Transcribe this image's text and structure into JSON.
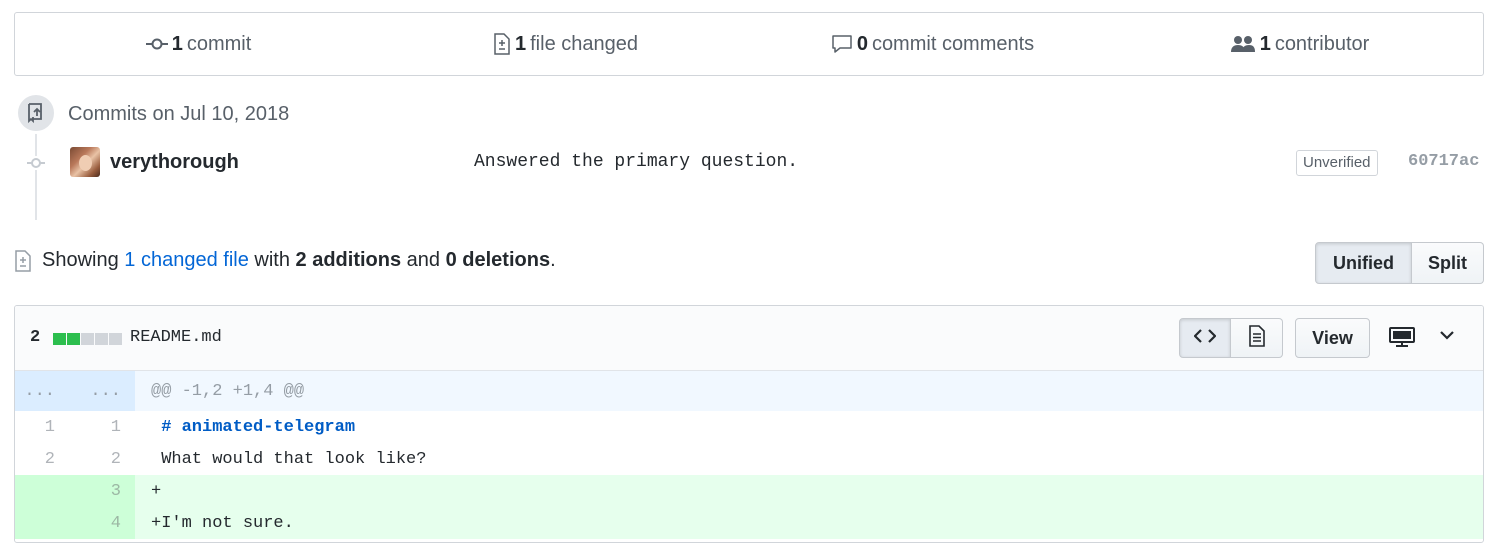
{
  "summary": {
    "commits_num": "1",
    "commits_label": "commit",
    "files_num": "1",
    "files_label": "file changed",
    "comments_num": "0",
    "comments_label": "commit comments",
    "contributors_num": "1",
    "contributors_label": "contributor"
  },
  "commits": {
    "date_heading": "Commits on Jul 10, 2018",
    "items": [
      {
        "author": "verythorough",
        "message": "Answered the primary question.",
        "badge": "Unverified",
        "sha": "60717ac"
      }
    ]
  },
  "toc": {
    "prefix": "Showing",
    "link": "1 changed file",
    "mid1": "with",
    "additions": "2 additions",
    "mid2": "and",
    "deletions": "0 deletions",
    "suffix": "."
  },
  "diff_view": {
    "unified_label": "Unified",
    "split_label": "Split",
    "selected": "Unified"
  },
  "file": {
    "diffstat_count": "2",
    "diffstat_blocks": [
      "add",
      "add",
      "neutral",
      "neutral",
      "neutral"
    ],
    "name": "README.md",
    "view_label": "View",
    "hunk": {
      "old_marker": "...",
      "new_marker": "...",
      "header": "@@ -1,2 +1,4 @@"
    },
    "lines": [
      {
        "type": "context",
        "old": "1",
        "new": "1",
        "prefix": " ",
        "text": "# animated-telegram"
      },
      {
        "type": "context",
        "old": "2",
        "new": "2",
        "prefix": " ",
        "text": "What would that look like?"
      },
      {
        "type": "add",
        "old": "",
        "new": "3",
        "prefix": "+",
        "text": ""
      },
      {
        "type": "add",
        "old": "",
        "new": "4",
        "prefix": "+",
        "text": "I'm not sure."
      }
    ]
  },
  "colors": {
    "link": "#0366d6",
    "addition_bg": "#e6ffed",
    "addition_num_bg": "#cdffd8",
    "hunk_bg": "#f1f8ff",
    "diffstat_add": "#2cbe4e"
  },
  "icons": [
    "git-commit-icon",
    "file-diff-icon",
    "comment-icon",
    "people-icon",
    "repo-push-icon",
    "code-icon",
    "file-text-icon",
    "desktop-icon",
    "chevron-down-icon"
  ]
}
